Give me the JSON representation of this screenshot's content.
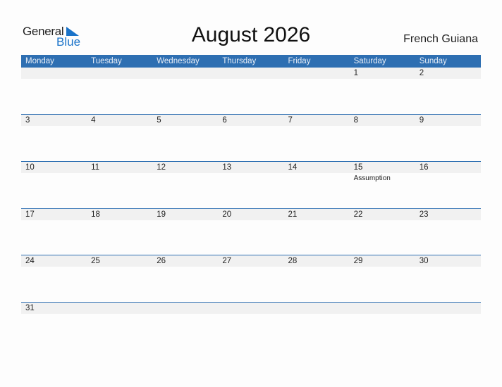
{
  "logo": {
    "word1": "General",
    "word2": "Blue"
  },
  "title": "August 2026",
  "country": "French Guiana",
  "colors": {
    "accent": "#2e6fb2",
    "band": "#f1f1f1",
    "logo_blue": "#1a73c9"
  },
  "weekdays": [
    "Monday",
    "Tuesday",
    "Wednesday",
    "Thursday",
    "Friday",
    "Saturday",
    "Sunday"
  ],
  "weeks": [
    [
      {
        "d": ""
      },
      {
        "d": ""
      },
      {
        "d": ""
      },
      {
        "d": ""
      },
      {
        "d": ""
      },
      {
        "d": "1"
      },
      {
        "d": "2"
      }
    ],
    [
      {
        "d": "3"
      },
      {
        "d": "4"
      },
      {
        "d": "5"
      },
      {
        "d": "6"
      },
      {
        "d": "7"
      },
      {
        "d": "8"
      },
      {
        "d": "9"
      }
    ],
    [
      {
        "d": "10"
      },
      {
        "d": "11"
      },
      {
        "d": "12"
      },
      {
        "d": "13"
      },
      {
        "d": "14"
      },
      {
        "d": "15",
        "event": "Assumption"
      },
      {
        "d": "16"
      }
    ],
    [
      {
        "d": "17"
      },
      {
        "d": "18"
      },
      {
        "d": "19"
      },
      {
        "d": "20"
      },
      {
        "d": "21"
      },
      {
        "d": "22"
      },
      {
        "d": "23"
      }
    ],
    [
      {
        "d": "24"
      },
      {
        "d": "25"
      },
      {
        "d": "26"
      },
      {
        "d": "27"
      },
      {
        "d": "28"
      },
      {
        "d": "29"
      },
      {
        "d": "30"
      }
    ],
    [
      {
        "d": "31"
      },
      {
        "d": ""
      },
      {
        "d": ""
      },
      {
        "d": ""
      },
      {
        "d": ""
      },
      {
        "d": ""
      },
      {
        "d": ""
      }
    ]
  ]
}
